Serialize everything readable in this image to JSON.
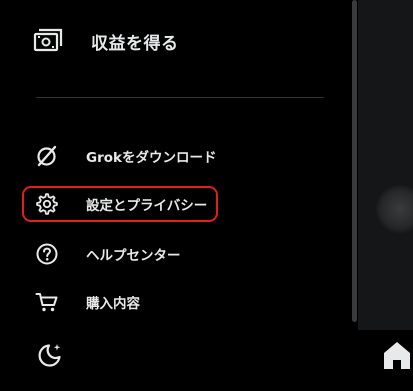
{
  "menu": {
    "earn": {
      "label": "収益を得る",
      "icon": "money-icon"
    },
    "items": [
      {
        "label": "Grokをダウンロード",
        "icon": "grok-icon"
      },
      {
        "label": "設定とプライバシー",
        "icon": "gear-icon",
        "highlighted": true
      },
      {
        "label": "ヘルプセンター",
        "icon": "help-icon"
      },
      {
        "label": "購入内容",
        "icon": "cart-icon"
      }
    ],
    "theme_toggle": {
      "icon": "moon-icon"
    }
  },
  "right_pane": {
    "nav_icon": "home-icon"
  },
  "colors": {
    "background": "#000000",
    "text": "#e7e9ea",
    "divider": "#2f3336",
    "highlight_border": "#e0201c",
    "right_pane": "#151617"
  }
}
